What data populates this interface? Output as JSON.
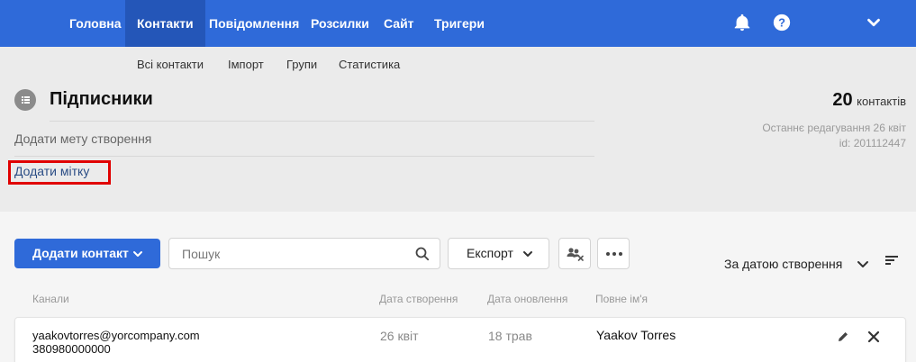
{
  "nav": {
    "items": [
      "Головна",
      "Контакти",
      "Повідомлення",
      "Розсилки",
      "Сайт",
      "Тригери"
    ],
    "active_index": 1
  },
  "subnav": {
    "items": [
      "Всі контакти",
      "Імпорт",
      "Групи",
      "Статистика"
    ]
  },
  "page": {
    "title": "Підписники",
    "goal_placeholder": "Додати мету створення",
    "add_tag": "Додати мітку",
    "count": "20",
    "count_label": "контактів",
    "last_edit": "Останнє редагування 26 квіт",
    "id_label": "id: 201112447"
  },
  "toolbar": {
    "add_contact": "Додати контакт",
    "search_placeholder": "Пошук",
    "export": "Експорт",
    "sort_label": "За датою створення"
  },
  "table": {
    "headers": [
      "Канали",
      "Дата створення",
      "Дата оновлення",
      "Повне ім'я"
    ],
    "rows": [
      {
        "email": "yaakovtorres@yorcompany.com",
        "phone": "380980000000",
        "created": "26 квіт",
        "updated": "18 трав",
        "name": "Yaakov Torres"
      }
    ]
  },
  "colors": {
    "nav_bg": "#2f6ad9",
    "nav_active": "#2456b8",
    "highlight": "#e00000"
  },
  "icons": [
    "bell-icon",
    "help-icon",
    "chevron-down-icon",
    "list-icon",
    "search-icon",
    "group-remove-icon",
    "more-icon",
    "sort-icon",
    "edit-icon",
    "close-icon"
  ]
}
